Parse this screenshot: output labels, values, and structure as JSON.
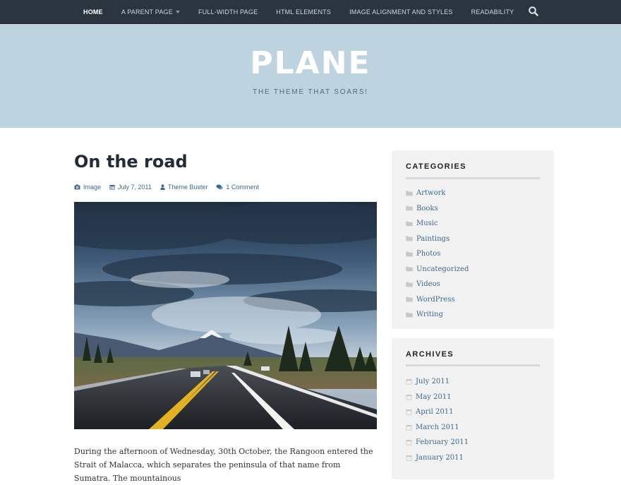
{
  "nav": {
    "items": [
      {
        "label": "HOME",
        "active": true
      },
      {
        "label": "A PARENT PAGE",
        "has_dropdown": true
      },
      {
        "label": "FULL-WIDTH PAGE"
      },
      {
        "label": "HTML ELEMENTS"
      },
      {
        "label": "IMAGE ALIGNMENT AND STYLES"
      },
      {
        "label": "READABILITY"
      }
    ],
    "search_icon": "search-icon"
  },
  "site": {
    "title": "PLANE",
    "tagline": "THE THEME THAT SOARS!"
  },
  "post": {
    "title": "On the road",
    "meta": {
      "format": "Image",
      "date": "July 7, 2011",
      "author": "Theme Buster",
      "comments": "1 Comment"
    },
    "excerpt": "During the afternoon of Wednesday, 30th October, the Rangoon entered the Strait of Malacca, which separates the peninsula of that name from Sumatra. The mountainous"
  },
  "sidebar": {
    "categories": {
      "title": "CATEGORIES",
      "items": [
        "Artwork",
        "Books",
        "Music",
        "Paintings",
        "Photos",
        "Uncategorized",
        "Videos",
        "WordPress",
        "Writing"
      ]
    },
    "archives": {
      "title": "ARCHIVES",
      "items": [
        "July 2011",
        "May 2011",
        "April 2011",
        "March 2011",
        "February 2011",
        "January 2011"
      ]
    }
  },
  "colors": {
    "nav_bg": "#2b3540",
    "masthead_bg": "#bdd4e0",
    "link": "#3c6a93",
    "widget_bg": "#f2f2f2"
  }
}
